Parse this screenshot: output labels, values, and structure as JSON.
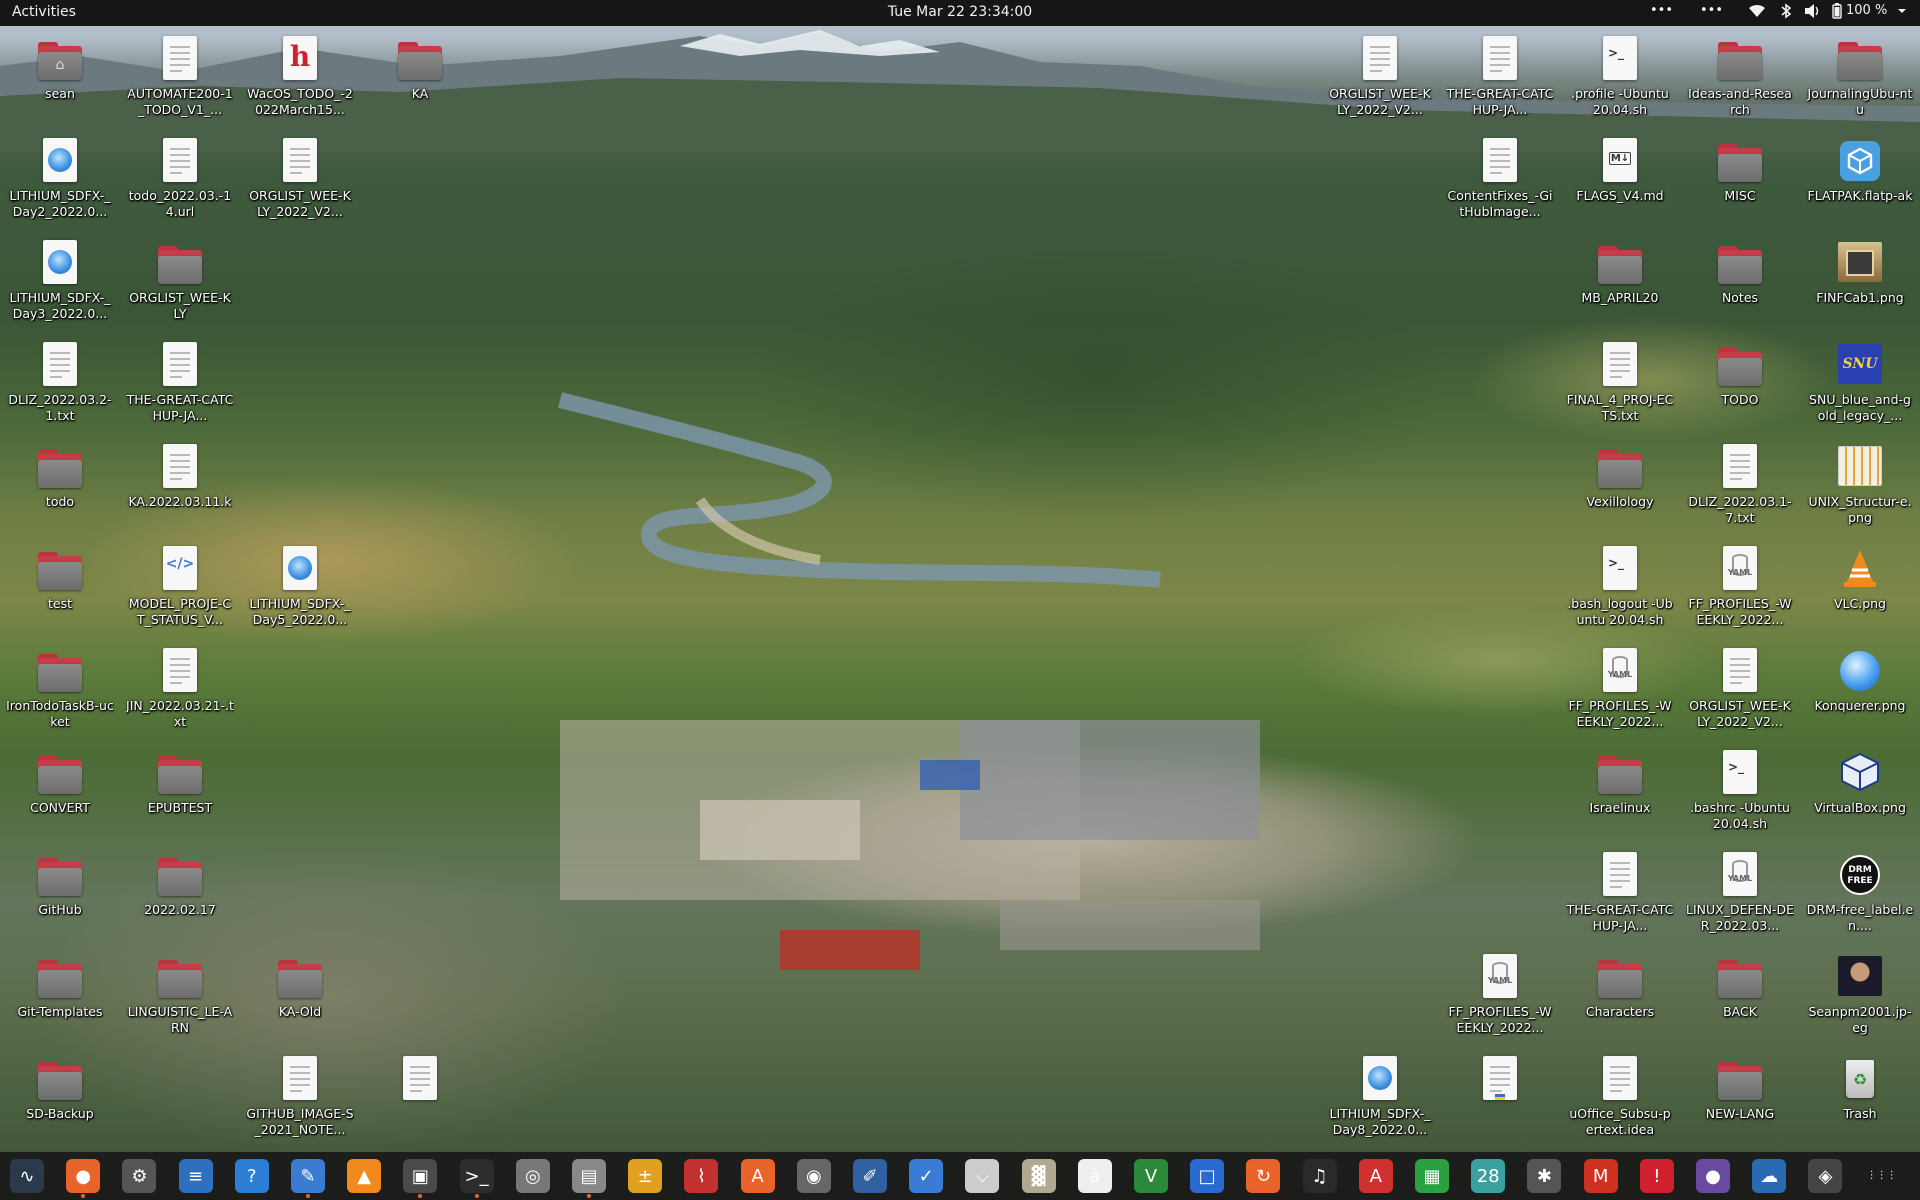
{
  "topbar": {
    "activities": "Activities",
    "clock": "Tue Mar 22  23:34:00",
    "overflow_1": "•••",
    "overflow_2": "•••",
    "battery": "100 %"
  },
  "desktop": {
    "icons": [
      {
        "label": "sean",
        "type": "home-folder"
      },
      {
        "label": "AUTOMATE200-1_TODO_V1_...",
        "type": "document"
      },
      {
        "label": "WacOS_TODO_-2022March15...",
        "type": "html-h"
      },
      {
        "label": "KA",
        "type": "folder"
      },
      {
        "label": "LITHIUM_SDFX-_Day2_2022.0...",
        "type": "web"
      },
      {
        "label": "todo_2022.03.-14.url",
        "type": "document"
      },
      {
        "label": "ORGLIST_WEE-KLY_2022_V2...",
        "type": "document"
      },
      {
        "label": "LITHIUM_SDFX-_Day3_2022.0...",
        "type": "web"
      },
      {
        "label": "ORGLIST_WEE-KLY",
        "type": "folder"
      },
      {
        "label": "DLIZ_2022.03.2-1.txt",
        "type": "document"
      },
      {
        "label": "THE-GREAT-CATCHUP-JA...",
        "type": "document"
      },
      {
        "label": "todo",
        "type": "folder"
      },
      {
        "label": "KA.2022.03.11.k",
        "type": "document"
      },
      {
        "label": "test",
        "type": "folder"
      },
      {
        "label": "MODEL_PROJE-CT_STATUS_V...",
        "type": "code"
      },
      {
        "label": "LITHIUM_SDFX-_Day5_2022.0...",
        "type": "web"
      },
      {
        "label": "IronTodoTaskB-ucket",
        "type": "folder"
      },
      {
        "label": "JIN_2022.03.21-.txt",
        "type": "document"
      },
      {
        "label": "CONVERT",
        "type": "folder"
      },
      {
        "label": "EPUBTEST",
        "type": "folder"
      },
      {
        "label": "GitHub",
        "type": "folder"
      },
      {
        "label": "2022.02.17",
        "type": "folder"
      },
      {
        "label": "Git-Templates",
        "type": "folder"
      },
      {
        "label": "LINGUISTIC_LE-ARN",
        "type": "folder"
      },
      {
        "label": "KA-Old",
        "type": "folder"
      },
      {
        "label": "SD-Backup",
        "type": "folder"
      },
      {
        "label": "GITHUB_IMAGE-S_2021_NOTE...",
        "type": "document"
      },
      {
        "label": "",
        "type": "document"
      },
      {
        "label": "ORGLIST_WEE-KLY_2022_V2...",
        "type": "document"
      },
      {
        "label": "THE-GREAT-CATCHUP-JA...",
        "type": "document"
      },
      {
        "label": ".profile -Ubuntu 20.04.sh",
        "type": "script"
      },
      {
        "label": "Ideas-and-Research",
        "type": "folder"
      },
      {
        "label": "JournalingUbu-ntu",
        "type": "folder"
      },
      {
        "label": "ContentFixes_-GitHubImage...",
        "type": "document"
      },
      {
        "label": "FLAGS_V4.md",
        "type": "markdown"
      },
      {
        "label": "MISC",
        "type": "folder"
      },
      {
        "label": "FLATPAK.flatp-ak",
        "type": "flatpak"
      },
      {
        "label": "MB_APRIL20",
        "type": "folder"
      },
      {
        "label": "Notes",
        "type": "folder"
      },
      {
        "label": "FINFCab1.png",
        "type": "image-cabinet"
      },
      {
        "label": "FINAL_4_PROJ-ECTS.txt",
        "type": "document"
      },
      {
        "label": "TODO",
        "type": "folder"
      },
      {
        "label": "SNU_blue_and-gold_legacy_...",
        "type": "image-snu"
      },
      {
        "label": "Vexillology",
        "type": "folder"
      },
      {
        "label": "DLIZ_2022.03.1-7.txt",
        "type": "document"
      },
      {
        "label": "UNIX_Structur-e.png",
        "type": "image-unix"
      },
      {
        "label": ".bash_logout -Ubuntu 20.04.sh",
        "type": "script"
      },
      {
        "label": "FF_PROFILES_-WEEKLY_2022...",
        "type": "yaml"
      },
      {
        "label": "VLC.png",
        "type": "image-vlc"
      },
      {
        "label": "FF_PROFILES_-WEEKLY_2022...",
        "type": "yaml"
      },
      {
        "label": "ORGLIST_WEE-KLY_2022_V2...",
        "type": "document"
      },
      {
        "label": "Konquerer.png",
        "type": "image-globe"
      },
      {
        "label": "Israelinux",
        "type": "folder"
      },
      {
        "label": ".bashrc -Ubuntu 20.04.sh",
        "type": "script"
      },
      {
        "label": "VirtualBox.png",
        "type": "image-vbox"
      },
      {
        "label": "THE-GREAT-CATCHUP-JA...",
        "type": "document"
      },
      {
        "label": "LINUX_DEFEN-DER_2022.03...",
        "type": "yaml"
      },
      {
        "label": "DRM-free_label.en....",
        "type": "image-drm"
      },
      {
        "label": "FF_PROFILES_-WEEKLY_2022...",
        "type": "yaml"
      },
      {
        "label": "Characters",
        "type": "folder"
      },
      {
        "label": "BACK",
        "type": "folder"
      },
      {
        "label": "Seanpm2001.jp-eg",
        "type": "image-photo"
      },
      {
        "label": "LITHIUM_SDFX-_Day8_2022.0...",
        "type": "web"
      },
      {
        "label": "",
        "type": "document-flag"
      },
      {
        "label": "uOffice_Subsu-pertext.idea",
        "type": "document"
      },
      {
        "label": "NEW-LANG",
        "type": "folder"
      },
      {
        "label": "Trash",
        "type": "trash"
      }
    ]
  },
  "dock": {
    "apps": [
      {
        "name": "system-monitor-icon",
        "glyph": "∿",
        "color": "#2b3a4a"
      },
      {
        "name": "firefox-icon",
        "glyph": "●",
        "color": "#e8642a"
      },
      {
        "name": "settings-icon",
        "glyph": "⚙",
        "color": "#555"
      },
      {
        "name": "document-viewer-icon",
        "glyph": "≡",
        "color": "#2f6fbf"
      },
      {
        "name": "help-icon",
        "glyph": "?",
        "color": "#2d7fd5"
      },
      {
        "name": "text-editor-icon",
        "glyph": "✎",
        "color": "#3b7bd0"
      },
      {
        "name": "vlc-icon",
        "glyph": "▲",
        "color": "#f08a1c"
      },
      {
        "name": "screenshot-tool-icon",
        "glyph": "▣",
        "color": "#4a4a4a"
      },
      {
        "name": "terminal-icon",
        "glyph": ">_",
        "color": "#2d2d2d"
      },
      {
        "name": "disk-usage-icon",
        "glyph": "◎",
        "color": "#777"
      },
      {
        "name": "files-icon",
        "glyph": "▤",
        "color": "#888"
      },
      {
        "name": "calculator-icon",
        "glyph": "±",
        "color": "#e0a020"
      },
      {
        "name": "system-monitor-graph-icon",
        "glyph": "⌇",
        "color": "#c23030"
      },
      {
        "name": "software-center-icon",
        "glyph": "A",
        "color": "#e8642a"
      },
      {
        "name": "disk-utility-icon",
        "glyph": "◉",
        "color": "#666"
      },
      {
        "name": "font-viewer-icon",
        "glyph": "✐",
        "color": "#3060a0"
      },
      {
        "name": "todo-icon",
        "glyph": "✓",
        "color": "#3a7bd5"
      },
      {
        "name": "usb-creator-icon",
        "glyph": "⌵",
        "color": "#ccc"
      },
      {
        "name": "archive-manager-icon",
        "glyph": "▓",
        "color": "#b0a890"
      },
      {
        "name": "character-map-icon",
        "glyph": "à",
        "color": "#eee"
      },
      {
        "name": "vim-icon",
        "glyph": "V",
        "color": "#2a8a3a"
      },
      {
        "name": "remote-desktop-icon",
        "glyph": "□",
        "color": "#2a6ad0"
      },
      {
        "name": "updater-icon",
        "glyph": "↻",
        "color": "#e8642a"
      },
      {
        "name": "music-icon",
        "glyph": "♫",
        "color": "#2a2a2a"
      },
      {
        "name": "pdf-reader-icon",
        "glyph": "A",
        "color": "#d03030"
      },
      {
        "name": "spreadsheet-icon",
        "glyph": "▦",
        "color": "#2aa040"
      },
      {
        "name": "calendar-icon",
        "glyph": "28",
        "color": "#3aa0a0"
      },
      {
        "name": "bug-tool-icon",
        "glyph": "✱",
        "color": "#555"
      },
      {
        "name": "mario-icon",
        "glyph": "M",
        "color": "#d03020"
      },
      {
        "name": "alert-icon",
        "glyph": "!",
        "color": "#d02030"
      },
      {
        "name": "screen-recorder-icon",
        "glyph": "●",
        "color": "#6a4aa0"
      },
      {
        "name": "weather-icon",
        "glyph": "☁",
        "color": "#2a6ab0"
      },
      {
        "name": "ubuntu-software-icon",
        "glyph": "◈",
        "color": "#444"
      },
      {
        "name": "show-apps-icon",
        "glyph": "⋮⋮⋮",
        "color": "transparent"
      }
    ]
  }
}
